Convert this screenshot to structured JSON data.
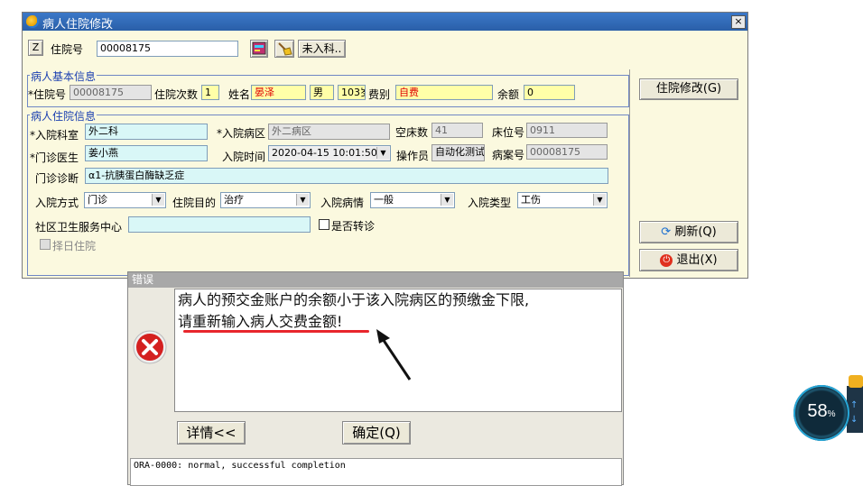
{
  "window": {
    "title": "病人住院修改",
    "close_label": "×"
  },
  "toolbar": {
    "z_label": "Z",
    "admission_no_label": "住院号",
    "admission_no_value": "00008175",
    "not_admitted_label": "未入科.."
  },
  "basic_info": {
    "group_label": "病人基本信息",
    "admission_no_label": "*住院号",
    "admission_no_value": "00008175",
    "times_label": "住院次数",
    "times_value": "1",
    "name_label": "姓名",
    "name_value": "晏泽",
    "sex_value": "男",
    "age_value": "103岁",
    "fee_type_label": "费别",
    "fee_type_value": "自费",
    "balance_label": "余额",
    "balance_value": "0"
  },
  "admission_info": {
    "group_label": "病人住院信息",
    "dept_label": "*入院科室",
    "dept_value": "外二科",
    "ward_label": "*入院病区",
    "ward_value": "外二病区",
    "empty_beds_label": "空床数",
    "empty_beds_value": "41",
    "bed_no_label": "床位号",
    "bed_no_value": "0911",
    "doctor_label": "*门诊医生",
    "doctor_value": "姜小燕",
    "admit_time_label": "入院时间",
    "admit_time_value": "2020-04-15 10:01:50",
    "operator_label": "操作员",
    "operator_value": "自动化测试",
    "case_no_label": "病案号",
    "case_no_value": "00008175",
    "diagnosis_label": "门诊诊断",
    "diagnosis_value": "α1-抗胰蛋白酶缺乏症",
    "admit_mode_label": "入院方式",
    "admit_mode_value": "门诊",
    "purpose_label": "住院目的",
    "purpose_value": "治疗",
    "condition_label": "入院病情",
    "condition_value": "一般",
    "admit_type_label": "入院类型",
    "admit_type_value": "工伤",
    "community_label": "社区卫生服务中心",
    "community_value": "",
    "transfer_label": "是否转诊",
    "choose_day_label": "择日住院"
  },
  "actions": {
    "modify_label": "住院修改(G)",
    "refresh_label": "刷新(Q)",
    "exit_label": "退出(X)"
  },
  "error_dialog": {
    "title": "错误",
    "message_line1": "病人的预交金账户的余额小于该入院病区的预缴金下限,",
    "message_line2": "请重新输入病人交费金额!",
    "details_label": "详情<<",
    "ok_label": "确定(Q)",
    "detail_text": "ORA-0000: normal, successful completion"
  },
  "widget": {
    "value": "58",
    "unit": "%"
  },
  "colors": {
    "title_bar": "#2a5fa8",
    "form_bg": "#fbf9df",
    "required_field": "#d9f7f7",
    "highlight_field": "#ffffa8",
    "error_icon": "#d42020",
    "annotation": "#e8262c"
  }
}
